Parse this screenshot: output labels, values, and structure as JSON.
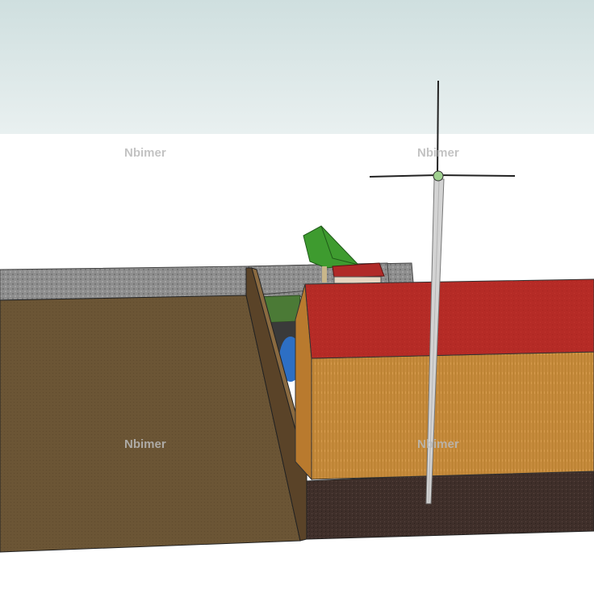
{
  "scene": {
    "type": "3d-model-viewport",
    "sky_color_top": "#cfdfdf",
    "sky_color_bottom": "#e6eeee",
    "ground_color": "#ffffff",
    "objects": [
      {
        "name": "gray-back-wall",
        "color": "#8e8e8e"
      },
      {
        "name": "brown-earth-embankment",
        "color": "#6b5535"
      },
      {
        "name": "dark-soil-base",
        "color": "#3f2f2a"
      },
      {
        "name": "barn",
        "roof_color": "#b52b26",
        "wall_color": "#c58a3c"
      },
      {
        "name": "wind-turbine",
        "pole_color": "#d3d3d3",
        "blade_color": "#222222"
      },
      {
        "name": "green-canopy",
        "color": "#3e9b2f"
      },
      {
        "name": "small-red-house",
        "roof_color": "#b02a28"
      },
      {
        "name": "blue-pipe-culvert",
        "color": "#2d6fc4"
      },
      {
        "name": "grass-patch",
        "color": "#4b7a36"
      }
    ]
  },
  "watermarks": [
    "Nbimer",
    "Nbimer",
    "Nbimer",
    "Nbimer"
  ]
}
